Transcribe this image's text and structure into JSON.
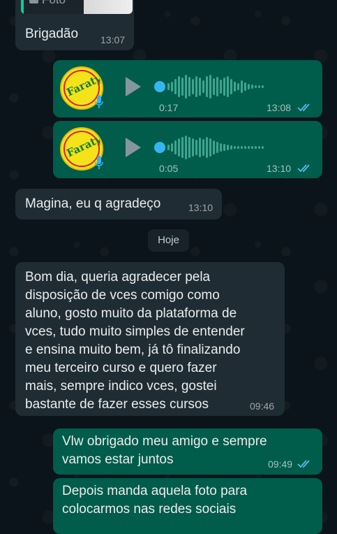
{
  "quoted": {
    "label": "Foto",
    "icon": "camera-icon"
  },
  "messages": {
    "m1": {
      "text": "Brigadão",
      "time": "13:07"
    },
    "voice1": {
      "duration": "0:17",
      "time": "13:08"
    },
    "voice2": {
      "duration": "0:05",
      "time": "13:10"
    },
    "m2": {
      "text": "Magina, eu q agradeço",
      "time": "13:10"
    },
    "m3": {
      "line1": "Bom dia, queria agradecer pela",
      "line2": "disposição de vces comigo como",
      "line3": "aluno, gosto muito da plataforma de",
      "line4": "vces, tudo muito simples de entender",
      "line5": "e ensina muito bem, já tô finalizando",
      "line6": "meu terceiro curso e quero fazer",
      "line7": "mais, sempre indico vces, gostei",
      "line8": "bastante de fazer esses cursos",
      "time": "09:46"
    },
    "m4": {
      "line1": "Vlw obrigado meu amigo e sempre",
      "line2": "vamos estar juntos",
      "time": "09:49"
    },
    "m5": {
      "line1": "Depois manda aquela foto para",
      "line2": "colocarmos nas redes sociais"
    }
  },
  "date_separator": "Hoje",
  "avatar_logo_text": "Faraty",
  "colors": {
    "incoming": "#202c33",
    "outgoing": "#005c4b",
    "read_tick": "#53bdeb",
    "background": "#0b141a"
  }
}
